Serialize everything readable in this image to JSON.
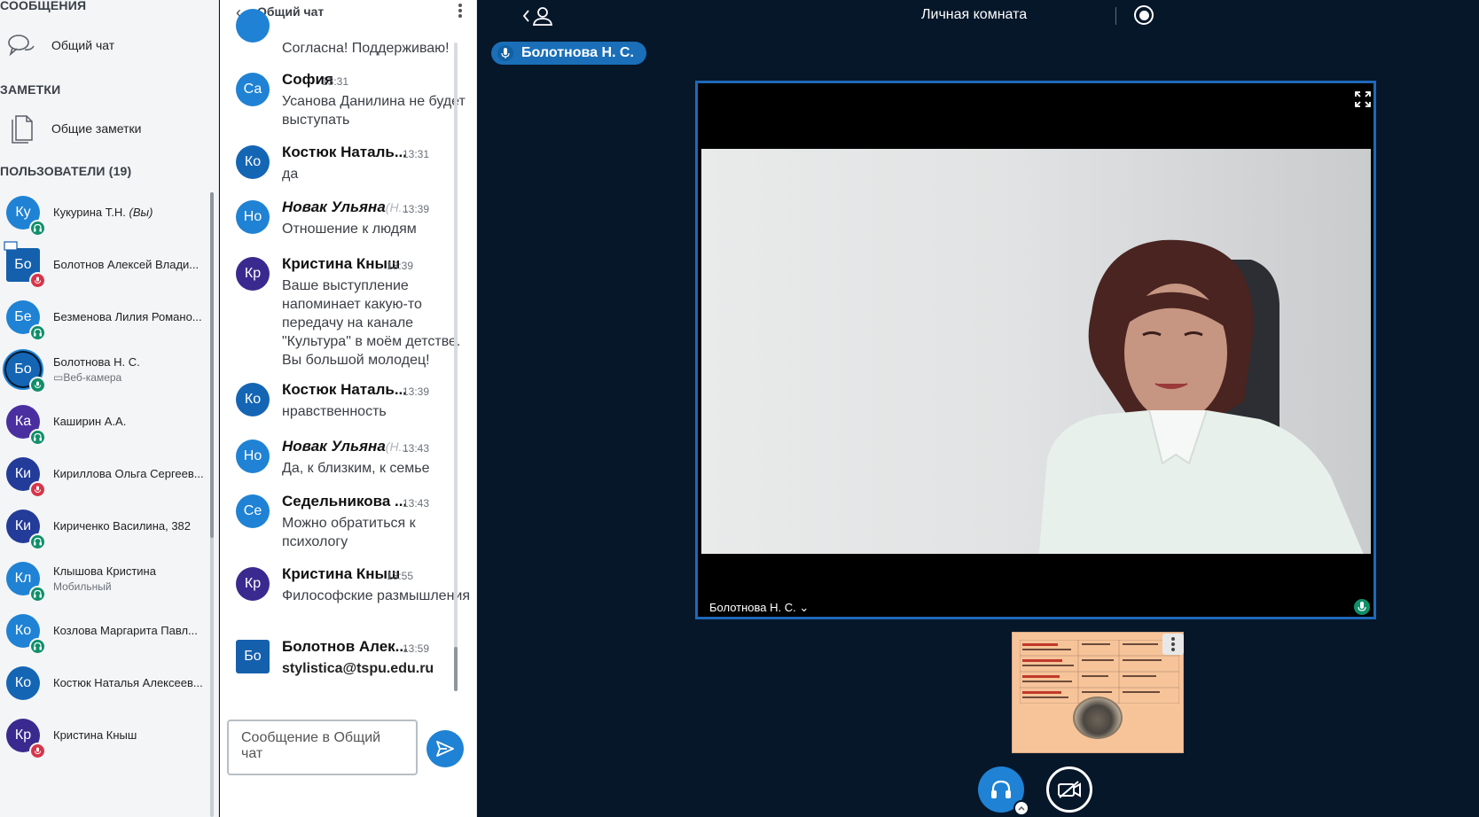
{
  "sidebar": {
    "messages_title": "СООБЩЕНИЯ",
    "public_chat_label": "Общий чат",
    "notes_title": "ЗАМЕТКИ",
    "shared_notes_label": "Общие заметки",
    "users_title": "ПОЛЬЗОВАТЕЛИ (19)",
    "you_suffix": "(Вы)",
    "users": [
      {
        "initials": "Ку",
        "name": "Кукурина Т.Н.",
        "sub": "",
        "color": "#1f82d4",
        "status": "listen"
      },
      {
        "initials": "Бо",
        "name": "Болотнов Алексей Влади...",
        "sub": "",
        "color": "#1560ad",
        "status": "muted"
      },
      {
        "initials": "Бе",
        "name": "Безменова Лилия Романо...",
        "sub": "",
        "color": "#1f82d4",
        "status": "listen"
      },
      {
        "initials": "Бо",
        "name": "Болотнова Н. С.",
        "sub": "Веб-камера",
        "color": "#1565b5",
        "status": "talking"
      },
      {
        "initials": "Ка",
        "name": "Каширин А.А.",
        "sub": "",
        "color": "#4a2fa0",
        "status": "listen"
      },
      {
        "initials": "Ки",
        "name": "Кириллова Ольга Сергеев...",
        "sub": "",
        "color": "#233b99",
        "status": "muted"
      },
      {
        "initials": "Ки",
        "name": "Кириченко Василина, 382",
        "sub": "",
        "color": "#233b99",
        "status": "listen"
      },
      {
        "initials": "Кл",
        "name": "Клышова Кристина",
        "sub": "Мобильный",
        "color": "#1f82d4",
        "status": "listen"
      },
      {
        "initials": "Ко",
        "name": "Козлова Маргарита Павл...",
        "sub": "",
        "color": "#1f82d4",
        "status": "listen"
      },
      {
        "initials": "Ко",
        "name": "Костюк Наталья Алексеев...",
        "sub": "",
        "color": "#1565b5",
        "status": "none"
      },
      {
        "initials": "Кр",
        "name": "Кристина Кныш",
        "sub": "",
        "color": "#3a2a8f",
        "status": "muted"
      }
    ]
  },
  "chat": {
    "title": "Общий чат",
    "top_partial": "Согласна! Поддерживаю!",
    "messages": [
      {
        "initials": "Са",
        "color": "#1f82d4",
        "name": "София",
        "time": "13:31",
        "text": "Усанова Данилина не будет выступать"
      },
      {
        "initials": "Ко",
        "color": "#1565b5",
        "name": "Костюк Наталь...",
        "time": "13:31",
        "text": "да"
      },
      {
        "initials": "Но",
        "color": "#1f82d4",
        "name": "Новак Ульяна",
        "name_extra": "(Н...",
        "time": "13:39",
        "text": "Отношение к людям"
      },
      {
        "initials": "Кр",
        "color": "#3a2a8f",
        "name": "Кристина Кныш",
        "time": "13:39",
        "text": "Ваше выступление напоминает какую-то передачу на канале \"Культура\" в моём детстве. Вы большой молодец!"
      },
      {
        "initials": "Ко",
        "color": "#1565b5",
        "name": "Костюк Наталь...",
        "time": "13:39",
        "text": "нравственность"
      },
      {
        "initials": "Но",
        "color": "#1f82d4",
        "name": "Новак Ульяна",
        "name_extra": "(Н...",
        "time": "13:43",
        "text": "Да, к близким, к семье"
      },
      {
        "initials": "Се",
        "color": "#1f82d4",
        "name": "Седельникова ...",
        "time": "13:43",
        "text": "Можно обратиться к психологу"
      },
      {
        "initials": "Кр",
        "color": "#3a2a8f",
        "name": "Кристина Кныш",
        "time": "13:55",
        "text": "Философские размышления"
      },
      {
        "initials": "Бо",
        "color": "#1560ad",
        "name": "Болотнов Алек...",
        "time": "13:59",
        "text": "stylistica@tspu.edu.ru"
      }
    ],
    "composer_placeholder": "Сообщение в Общий чат"
  },
  "main": {
    "room_title": "Личная комната",
    "talker_name": "Болотнова Н. С.",
    "video_name": "Болотнова Н. С. ⌄"
  },
  "colors": {
    "background": "#06172a",
    "accent": "#1f82d4",
    "status_green": "#0f8f6a",
    "status_red": "#d6364a"
  }
}
